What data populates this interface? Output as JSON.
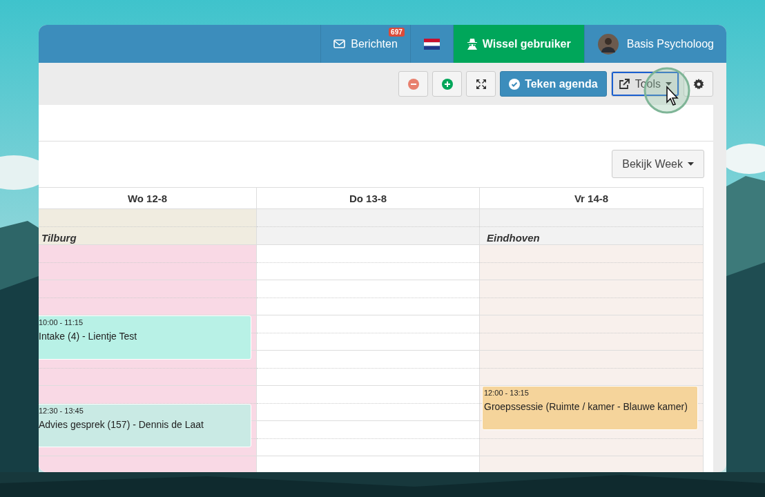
{
  "header": {
    "messages": {
      "label": "Berichten",
      "badge": "697"
    },
    "switch_user": {
      "label": "Wissel gebruiker"
    },
    "user": {
      "name": "Basis Psycholoog"
    }
  },
  "toolbar": [
    {
      "kind": "remove"
    },
    {
      "kind": "add"
    },
    {
      "kind": "fullscreen"
    },
    {
      "kind": "primary",
      "label": "Teken agenda"
    },
    {
      "kind": "tools",
      "label": "Tools",
      "focused": true
    },
    {
      "kind": "settings"
    }
  ],
  "view_button": {
    "label": "Bekijk Week"
  },
  "calendar": {
    "days": [
      {
        "header": "Wo 12-8",
        "location": "Tilburg",
        "kind": "pink",
        "events": [
          {
            "time": "10:00 - 11:15",
            "title": "Intake (4) - Lientje Test",
            "color": "#b8f1e6"
          },
          {
            "time": "12:30 - 13:45",
            "title": "Advies gesprek (157) - Dennis de Laat",
            "color": "#c9eae4"
          }
        ]
      },
      {
        "header": "Do 13-8",
        "kind": "plain"
      },
      {
        "header": "Vr 14-8",
        "location": "Eindhoven",
        "kind": "beige",
        "events": [
          {
            "time": "12:00 - 13:15",
            "title": "Groepssessie (Ruimte / kamer - Blauwe kamer)",
            "color": "#f5d49b"
          }
        ]
      }
    ]
  }
}
